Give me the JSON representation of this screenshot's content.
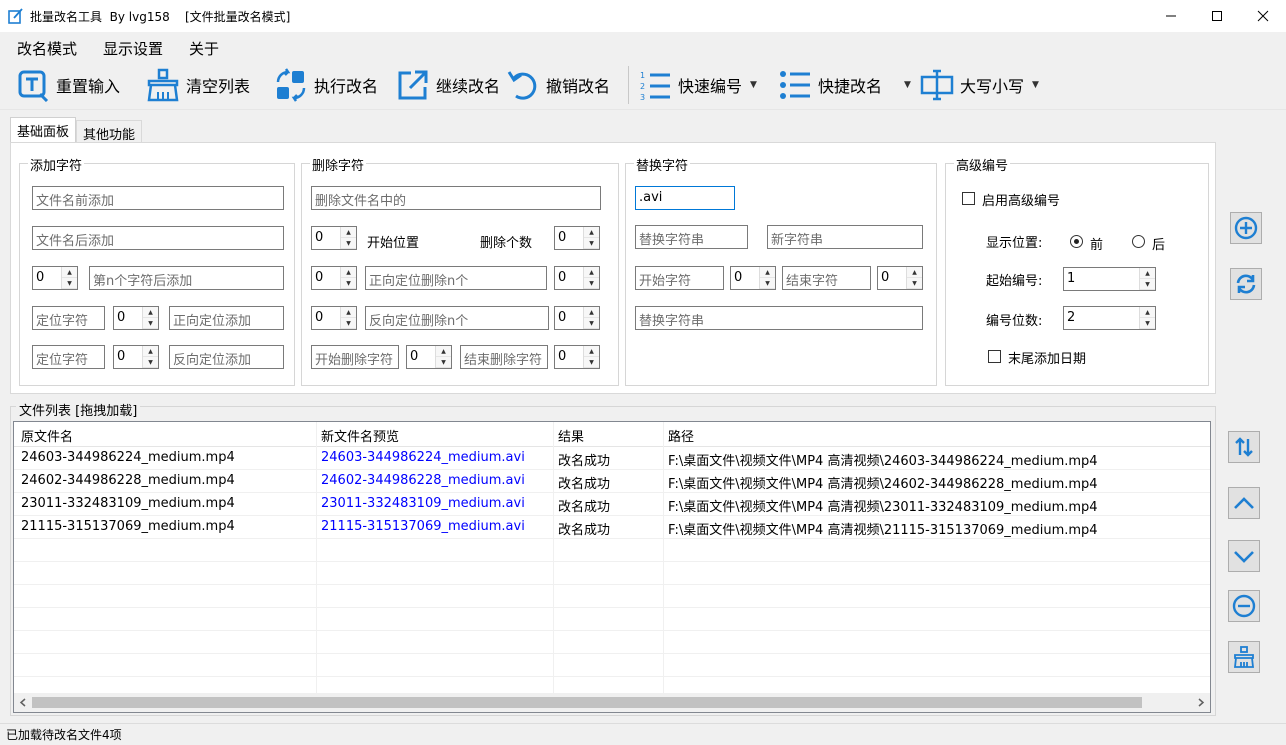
{
  "window": {
    "title": "批量改名工具  By lvg158    [文件批量改名模式]"
  },
  "menu": [
    "改名模式",
    "显示设置",
    "关于"
  ],
  "toolbar": {
    "reset": "重置输入",
    "clear": "清空列表",
    "execute": "执行改名",
    "continue": "继续改名",
    "undo": "撤销改名",
    "quick_number": "快速编号",
    "quick_rename": "快捷改名",
    "case": "大写小写"
  },
  "tabs": [
    "基础面板",
    "其他功能"
  ],
  "add_group": {
    "title": "添加字符",
    "prefix_placeholder": "文件名前添加",
    "suffix_placeholder": "文件名后添加",
    "nth_value": "0",
    "nth_placeholder": "第n个字符后添加",
    "locate_placeholder_1": "定位字符",
    "locate_num_1": "0",
    "forward_add_placeholder": "正向定位添加",
    "locate_placeholder_2": "定位字符",
    "locate_num_2": "0",
    "reverse_add_placeholder": "反向定位添加"
  },
  "delete_group": {
    "title": "删除字符",
    "delete_placeholder": "删除文件名中的",
    "start_value": "0",
    "start_label": "开始位置",
    "count_label": "删除个数",
    "count_value": "0",
    "fwd_value": "0",
    "fwd_placeholder": "正向定位删除n个",
    "fwd_count": "0",
    "rev_value": "0",
    "rev_placeholder": "反向定位删除n个",
    "rev_count": "0",
    "start_char_placeholder": "开始删除字符",
    "start_char_num": "0",
    "end_char_placeholder": "结束删除字符",
    "end_char_num": "0"
  },
  "replace_group": {
    "title": "替换字符",
    "find_value": ".avi",
    "replace_placeholder": "替换字符串",
    "new_placeholder": "新字符串",
    "start_char_placeholder": "开始字符",
    "start_num": "0",
    "end_char_placeholder": "结束字符",
    "end_num": "0",
    "replace2_placeholder": "替换字符串"
  },
  "advanced_group": {
    "title": "高级编号",
    "enable_label": "启用高级编号",
    "position_label": "显示位置:",
    "before_label": "前",
    "after_label": "后",
    "start_label": "起始编号:",
    "start_value": "1",
    "digits_label": "编号位数:",
    "digits_value": "2",
    "date_label": "末尾添加日期"
  },
  "file_list": {
    "title": "文件列表 [拖拽加载]",
    "columns": [
      "原文件名",
      "新文件名预览",
      "结果",
      "路径"
    ],
    "rows": [
      [
        "24603-344986224_medium.mp4",
        "24603-344986224_medium.avi",
        "改名成功",
        "F:\\桌面文件\\视频文件\\MP4 高清视频\\24603-344986224_medium.mp4"
      ],
      [
        "24602-344986228_medium.mp4",
        "24602-344986228_medium.avi",
        "改名成功",
        "F:\\桌面文件\\视频文件\\MP4 高清视频\\24602-344986228_medium.mp4"
      ],
      [
        "23011-332483109_medium.mp4",
        "23011-332483109_medium.avi",
        "改名成功",
        "F:\\桌面文件\\视频文件\\MP4 高清视频\\23011-332483109_medium.mp4"
      ],
      [
        "21115-315137069_medium.mp4",
        "21115-315137069_medium.avi",
        "改名成功",
        "F:\\桌面文件\\视频文件\\MP4 高清视频\\21115-315137069_medium.mp4"
      ]
    ]
  },
  "status": "已加载待改名文件4项",
  "colors": {
    "accent": "#1e7fd2",
    "preview_text": "#0000ff"
  }
}
